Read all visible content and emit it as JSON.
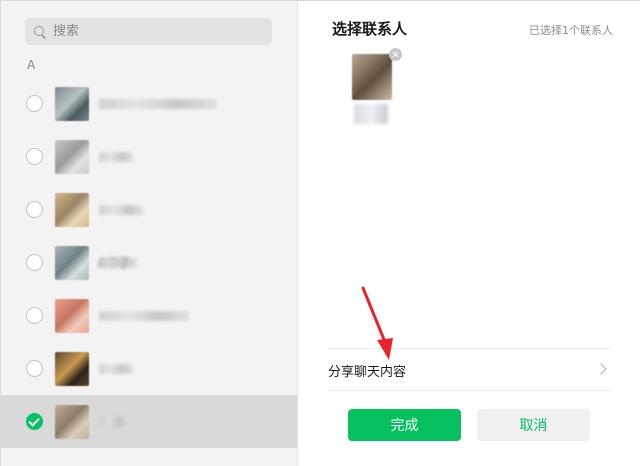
{
  "search": {
    "placeholder": "搜索"
  },
  "section_letter": "A",
  "contacts": [
    {
      "name": "",
      "avatar_colors": [
        "#7a8b8e",
        "#b7c3c4",
        "#4d5b5e"
      ],
      "checked": false
    },
    {
      "name": "",
      "avatar_colors": [
        "#c8c8c8",
        "#9b9b9b",
        "#e2e2e2"
      ],
      "checked": false
    },
    {
      "name": "",
      "avatar_colors": [
        "#d6b98a",
        "#9a8465",
        "#e8d6b5"
      ],
      "checked": false
    },
    {
      "name": "A单子",
      "avatar_colors": [
        "#a9b7b8",
        "#6f8184",
        "#d7dede"
      ],
      "checked": false
    },
    {
      "name": "",
      "avatar_colors": [
        "#e6a08c",
        "#c77763",
        "#f2cbbd"
      ],
      "checked": false
    },
    {
      "name": "",
      "avatar_colors": [
        "#5b4630",
        "#c99b52",
        "#2f2419"
      ],
      "checked": false
    },
    {
      "name": "",
      "avatar_colors": [
        "#bfb09a",
        "#8c7c68",
        "#d8ccba"
      ],
      "checked": true
    }
  ],
  "right": {
    "title": "选择联系人",
    "selected_count": "已选择1个联系人",
    "share_label": "分享聊天内容",
    "done_label": "完成",
    "cancel_label": "取消"
  },
  "colors": {
    "accent": "#07c160",
    "annotation": "#e8232a"
  }
}
